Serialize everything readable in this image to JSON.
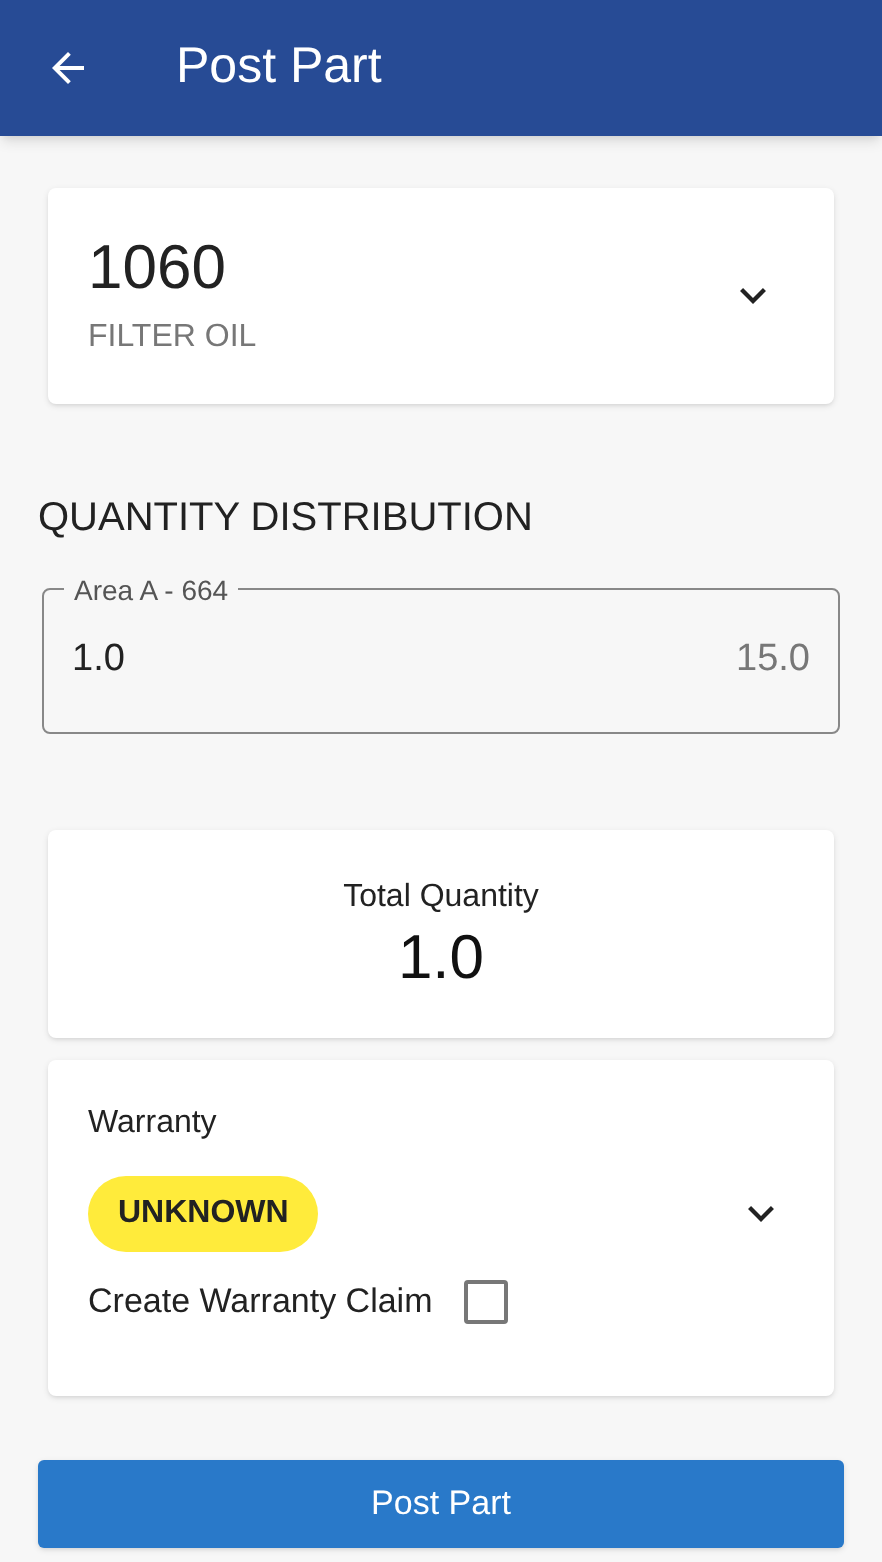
{
  "app_bar": {
    "title": "Post Part"
  },
  "part": {
    "number": "1060",
    "description": "FILTER OIL"
  },
  "section_title": "QUANTITY DISTRIBUTION",
  "distribution_field": {
    "label": "Area A - 664",
    "value": "1.0",
    "available": "15.0"
  },
  "total": {
    "label": "Total Quantity",
    "value": "1.0"
  },
  "warranty": {
    "label": "Warranty",
    "status": "UNKNOWN",
    "color": "#ffeb3b",
    "claim_label": "Create Warranty Claim",
    "claim_checked": false
  },
  "submit_button": "Post Part"
}
